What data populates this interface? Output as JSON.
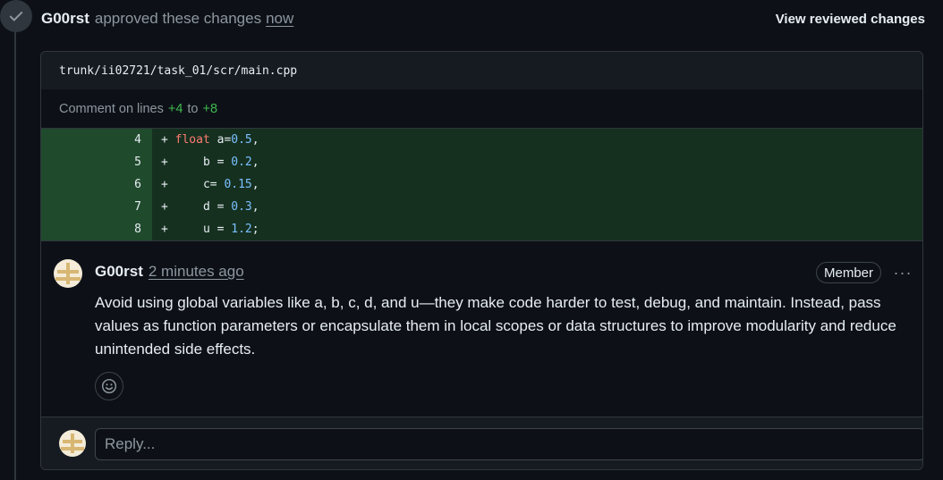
{
  "timeline": {
    "actor": "G00rst",
    "action": "approved these changes",
    "time": "now",
    "view_button": "View reviewed changes"
  },
  "file": {
    "path": "trunk/ii02721/task_01/scr/main.cpp",
    "comment_prefix": "Comment on lines",
    "line_start": "+4",
    "line_to": "to",
    "line_end": "+8"
  },
  "diff_lines": [
    {
      "num": "4",
      "sign": "+",
      "indent": " ",
      "kw": "float",
      "text": " a=",
      "val": "0.5",
      "end": ","
    },
    {
      "num": "5",
      "sign": "+",
      "indent": "     ",
      "kw": "",
      "text": "b = ",
      "val": "0.2",
      "end": ","
    },
    {
      "num": "6",
      "sign": "+",
      "indent": "     ",
      "kw": "",
      "text": "c= ",
      "val": "0.15",
      "end": ","
    },
    {
      "num": "7",
      "sign": "+",
      "indent": "     ",
      "kw": "",
      "text": "d = ",
      "val": "0.3",
      "end": ","
    },
    {
      "num": "8",
      "sign": "+",
      "indent": "     ",
      "kw": "",
      "text": "u = ",
      "val": "1.2",
      "end": ";"
    }
  ],
  "comment": {
    "author": "G00rst",
    "time": "2 minutes ago",
    "role": "Member",
    "more": "···",
    "body": "Avoid using global variables like a, b, c, d, and u—they make code harder to test, debug, and maintain. Instead, pass values as function parameters or encapsulate them in local scopes or data structures to improve modularity and reduce unintended side effects."
  },
  "reply": {
    "placeholder": "Reply..."
  },
  "colors": {
    "background": "#0d1117",
    "added_line": "#15301f",
    "added_gutter": "#1f4b2c",
    "green": "#3fb950",
    "keyword": "#ff7b72",
    "number": "#79c0ff"
  }
}
